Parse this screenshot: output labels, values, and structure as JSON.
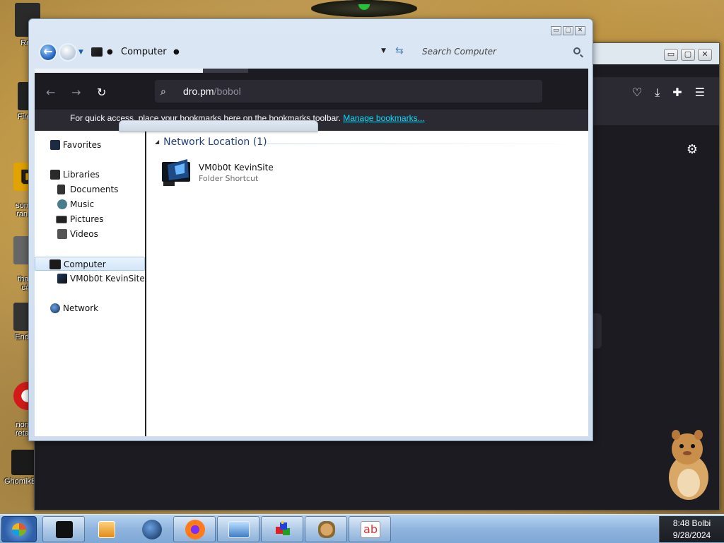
{
  "desktop": {
    "icons": [
      {
        "label": "Rec",
        "color": "#2a2a2a"
      },
      {
        "label": "Firefo",
        "color": "#222"
      },
      {
        "label": "some r\nran a r",
        "color": "#e0a300"
      },
      {
        "label": "that b\nc#.l",
        "color": "#666"
      },
      {
        "label": "Endern",
        "color": "#333"
      },
      {
        "label": "none c\nretards",
        "color": "#d31a1a"
      },
      {
        "label": "GhomikBox...",
        "color": "#222"
      }
    ]
  },
  "firefox": {
    "url": "dro.pm",
    "url_path": "/bobol",
    "bookmarks_text": "For quick access, place your bookmarks here on the bookmarks toolbar.",
    "bookmarks_link": "Manage bookmarks...",
    "controls": {
      "minimize": "▭",
      "maximize": "▢",
      "close": "✕"
    }
  },
  "explorer": {
    "address": "Computer",
    "search_placeholder": "Search Computer",
    "controls": {
      "minimize": "▭",
      "maximize": "▢",
      "close": "✕"
    },
    "nav": {
      "favorites": "Favorites",
      "libraries": "Libraries",
      "documents": "Documents",
      "music": "Music",
      "pictures": "Pictures",
      "videos": "Videos",
      "computer": "Computer",
      "kevinsite": "VM0b0t KevinSite",
      "network": "Network"
    },
    "group_header": "Network Location (1)",
    "items": [
      {
        "name": "VM0b0t KevinSite",
        "type": "Folder Shortcut"
      }
    ]
  },
  "taskbar": {
    "time": "8:48 Bolbi",
    "date": "9/28/2024"
  }
}
